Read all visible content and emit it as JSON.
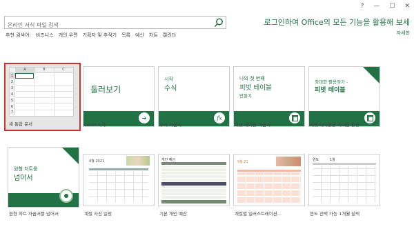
{
  "window": {
    "help": "?",
    "minimize": "—",
    "restore": "☐",
    "close": "✕"
  },
  "search": {
    "placeholder": "온라인 서식 파일 검색"
  },
  "suggested": {
    "lead": "추천 검색어:",
    "terms": [
      "비즈니스",
      "개인 우편",
      "기획자 및 추적기",
      "목록",
      "예산",
      "차트",
      "캘린더"
    ]
  },
  "signin": {
    "text": "로그인하여 Office의 모든 기능을 활용해 보세",
    "learn_more": "자세한"
  },
  "templates": [
    {
      "caption": "새 통합 문서",
      "sheet_cols": [
        "A",
        "B",
        "C"
      ],
      "sheet_rows": [
        "1",
        "2",
        "3",
        "4",
        "5",
        "6",
        "7"
      ]
    },
    {
      "caption": "Excel 시작",
      "title": "둘러보기"
    },
    {
      "caption": "수식 자습서",
      "title_small": "시작",
      "title": "수식"
    },
    {
      "caption": "피벗 테이블 자습서",
      "title_small": "나의 첫 번째",
      "title": "피벗 테이블",
      "subtitle": "만들기"
    },
    {
      "caption": "피벗 테이블을 최대한 활용",
      "title_small": "최대한 활용하기 -",
      "title": "피벗 테이블"
    },
    {
      "caption": "원형 차트 자습서를 넘어서",
      "title_small": "원형 차트를",
      "title": "넘어서"
    },
    {
      "caption": "계절 사진 일정",
      "header": "4월 2021"
    },
    {
      "caption": "기본 개인 예산",
      "header": "개인 예산"
    },
    {
      "caption": "계절별 일러스트레이션...",
      "header": "9월 21"
    },
    {
      "caption": "연도 선택 가능 1개월 달력",
      "header_left": "연도",
      "header_right": "1월"
    }
  ],
  "colors": {
    "accent": "#217346",
    "selection": "#d03030"
  }
}
